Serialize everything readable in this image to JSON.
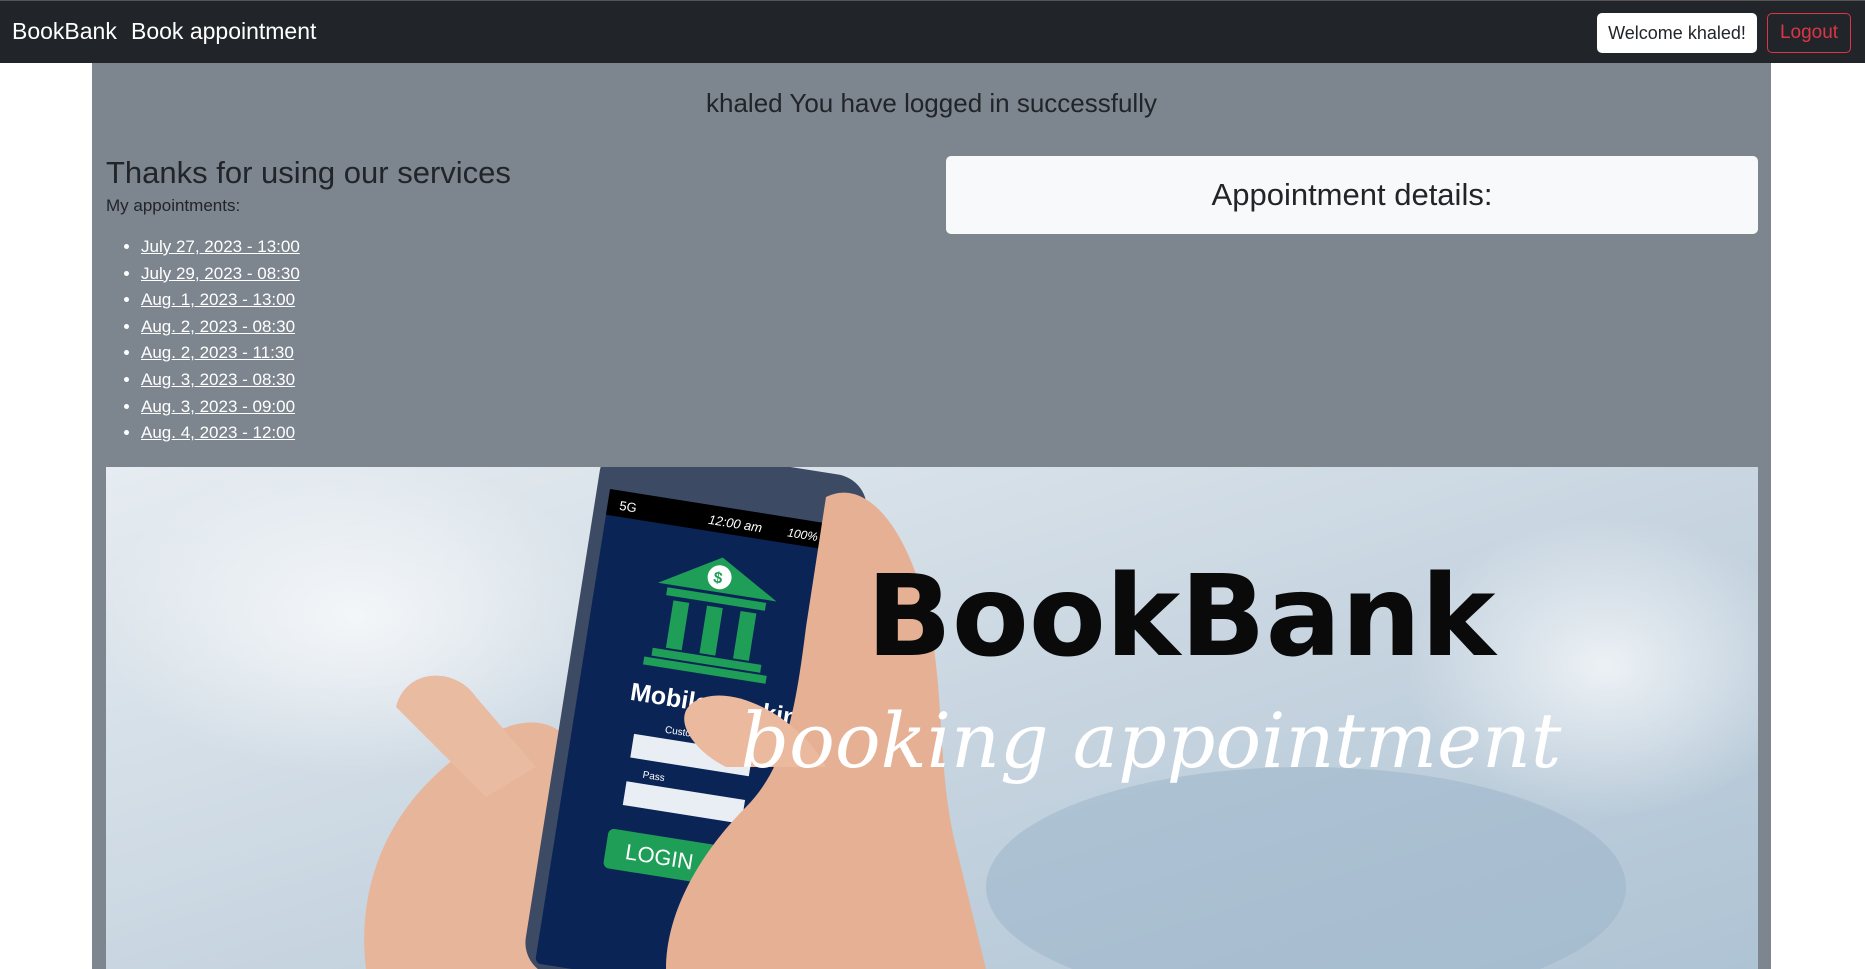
{
  "navbar": {
    "brand": "BookBank",
    "book_link": "Book appointment",
    "welcome": "Welcome khaled!",
    "logout": "Logout"
  },
  "main": {
    "success_message": "khaled You have logged in successfully",
    "thanks_heading": "Thanks for using our services",
    "my_appointments_label": "My appointments:",
    "appointments": [
      "July 27, 2023 - 13:00",
      "July 29, 2023 - 08:30",
      "Aug. 1, 2023 - 13:00",
      "Aug. 2, 2023 - 08:30",
      "Aug. 2, 2023 - 11:30",
      "Aug. 3, 2023 - 08:30",
      "Aug. 3, 2023 - 09:00",
      "Aug. 4, 2023 - 12:00"
    ],
    "details_heading": "Appointment details:"
  },
  "banner": {
    "title": "BookBank",
    "subtitle": "booking appointment",
    "phone": {
      "signal": "5G",
      "time": "12:00 am",
      "battery": "100%",
      "app_title": "Mobile Banking",
      "customer_label": "Customer ID",
      "password_label": "Pass",
      "login_button": "LOGIN"
    }
  },
  "colors": {
    "navbar": "#212529",
    "main_bg": "#7d858e",
    "logout": "#dc3545",
    "app_green": "#1e9e57",
    "app_blue": "#0b2456"
  }
}
